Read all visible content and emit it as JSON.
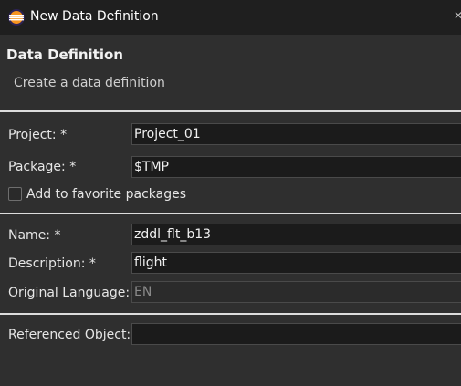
{
  "window": {
    "title": "New Data Definition",
    "close_glyph": "✕"
  },
  "header": {
    "heading": "Data Definition",
    "subheading": "Create a data definition"
  },
  "form": {
    "project": {
      "label": "Project: *",
      "value": "Project_01"
    },
    "package": {
      "label": "Package: *",
      "value": "$TMP"
    },
    "favorite": {
      "label": "Add to favorite packages",
      "checked": false
    },
    "name": {
      "label": "Name: *",
      "value": "zddl_flt_b13"
    },
    "description": {
      "label": "Description: *",
      "value": "flight"
    },
    "original_language": {
      "label": "Original Language:",
      "value": "EN"
    },
    "referenced_object": {
      "label": "Referenced Object:",
      "value": ""
    }
  },
  "icons": {
    "app": "eclipse-icon",
    "close": "close-icon"
  }
}
